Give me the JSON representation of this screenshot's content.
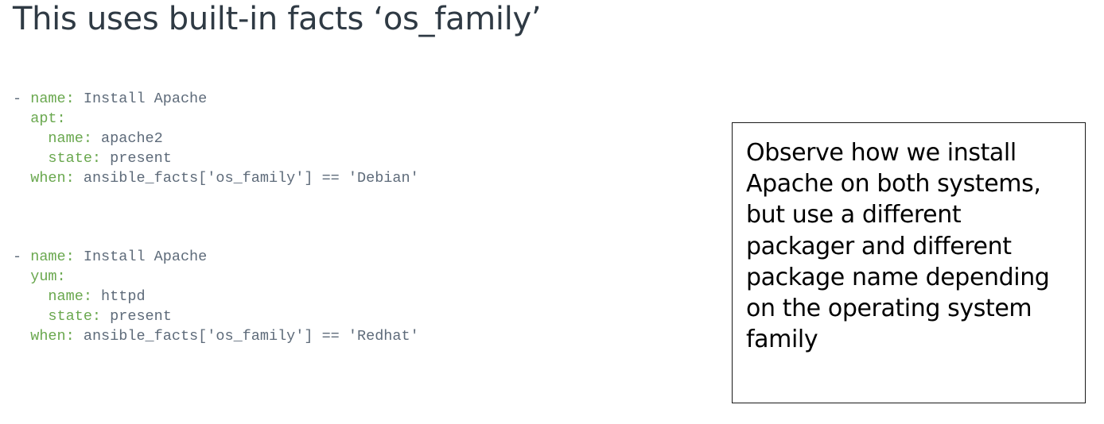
{
  "slide": {
    "title": "This uses built-in facts ‘os_family’"
  },
  "code_blocks": [
    {
      "lines": [
        {
          "indent": "",
          "prefix": "- ",
          "key": "name:",
          "value": " Install Apache"
        },
        {
          "indent": "  ",
          "prefix": "",
          "key": "apt:",
          "value": ""
        },
        {
          "indent": "    ",
          "prefix": "",
          "key": "name:",
          "value": " apache2"
        },
        {
          "indent": "    ",
          "prefix": "",
          "key": "state:",
          "value": " present"
        },
        {
          "indent": "  ",
          "prefix": "",
          "key": "when:",
          "value": " ansible_facts['os_family'] == 'Debian'"
        }
      ]
    },
    {
      "lines": [
        {
          "indent": "",
          "prefix": "- ",
          "key": "name:",
          "value": " Install Apache"
        },
        {
          "indent": "  ",
          "prefix": "",
          "key": "yum:",
          "value": ""
        },
        {
          "indent": "    ",
          "prefix": "",
          "key": "name:",
          "value": " httpd"
        },
        {
          "indent": "    ",
          "prefix": "",
          "key": "state:",
          "value": " present"
        },
        {
          "indent": "  ",
          "prefix": "",
          "key": "when:",
          "value": " ansible_facts['os_family'] == 'Redhat'"
        }
      ]
    }
  ],
  "note": {
    "lines": [
      "Observe how we install",
      "Apache on both systems,",
      "but use a different",
      "packager and different",
      "package name depending",
      "on the operating system",
      "family"
    ]
  },
  "colors": {
    "title": "#2f3a44",
    "code_key": "#6aa84f",
    "code_text": "#5e6b7a",
    "note_border": "#1a1a1a"
  }
}
